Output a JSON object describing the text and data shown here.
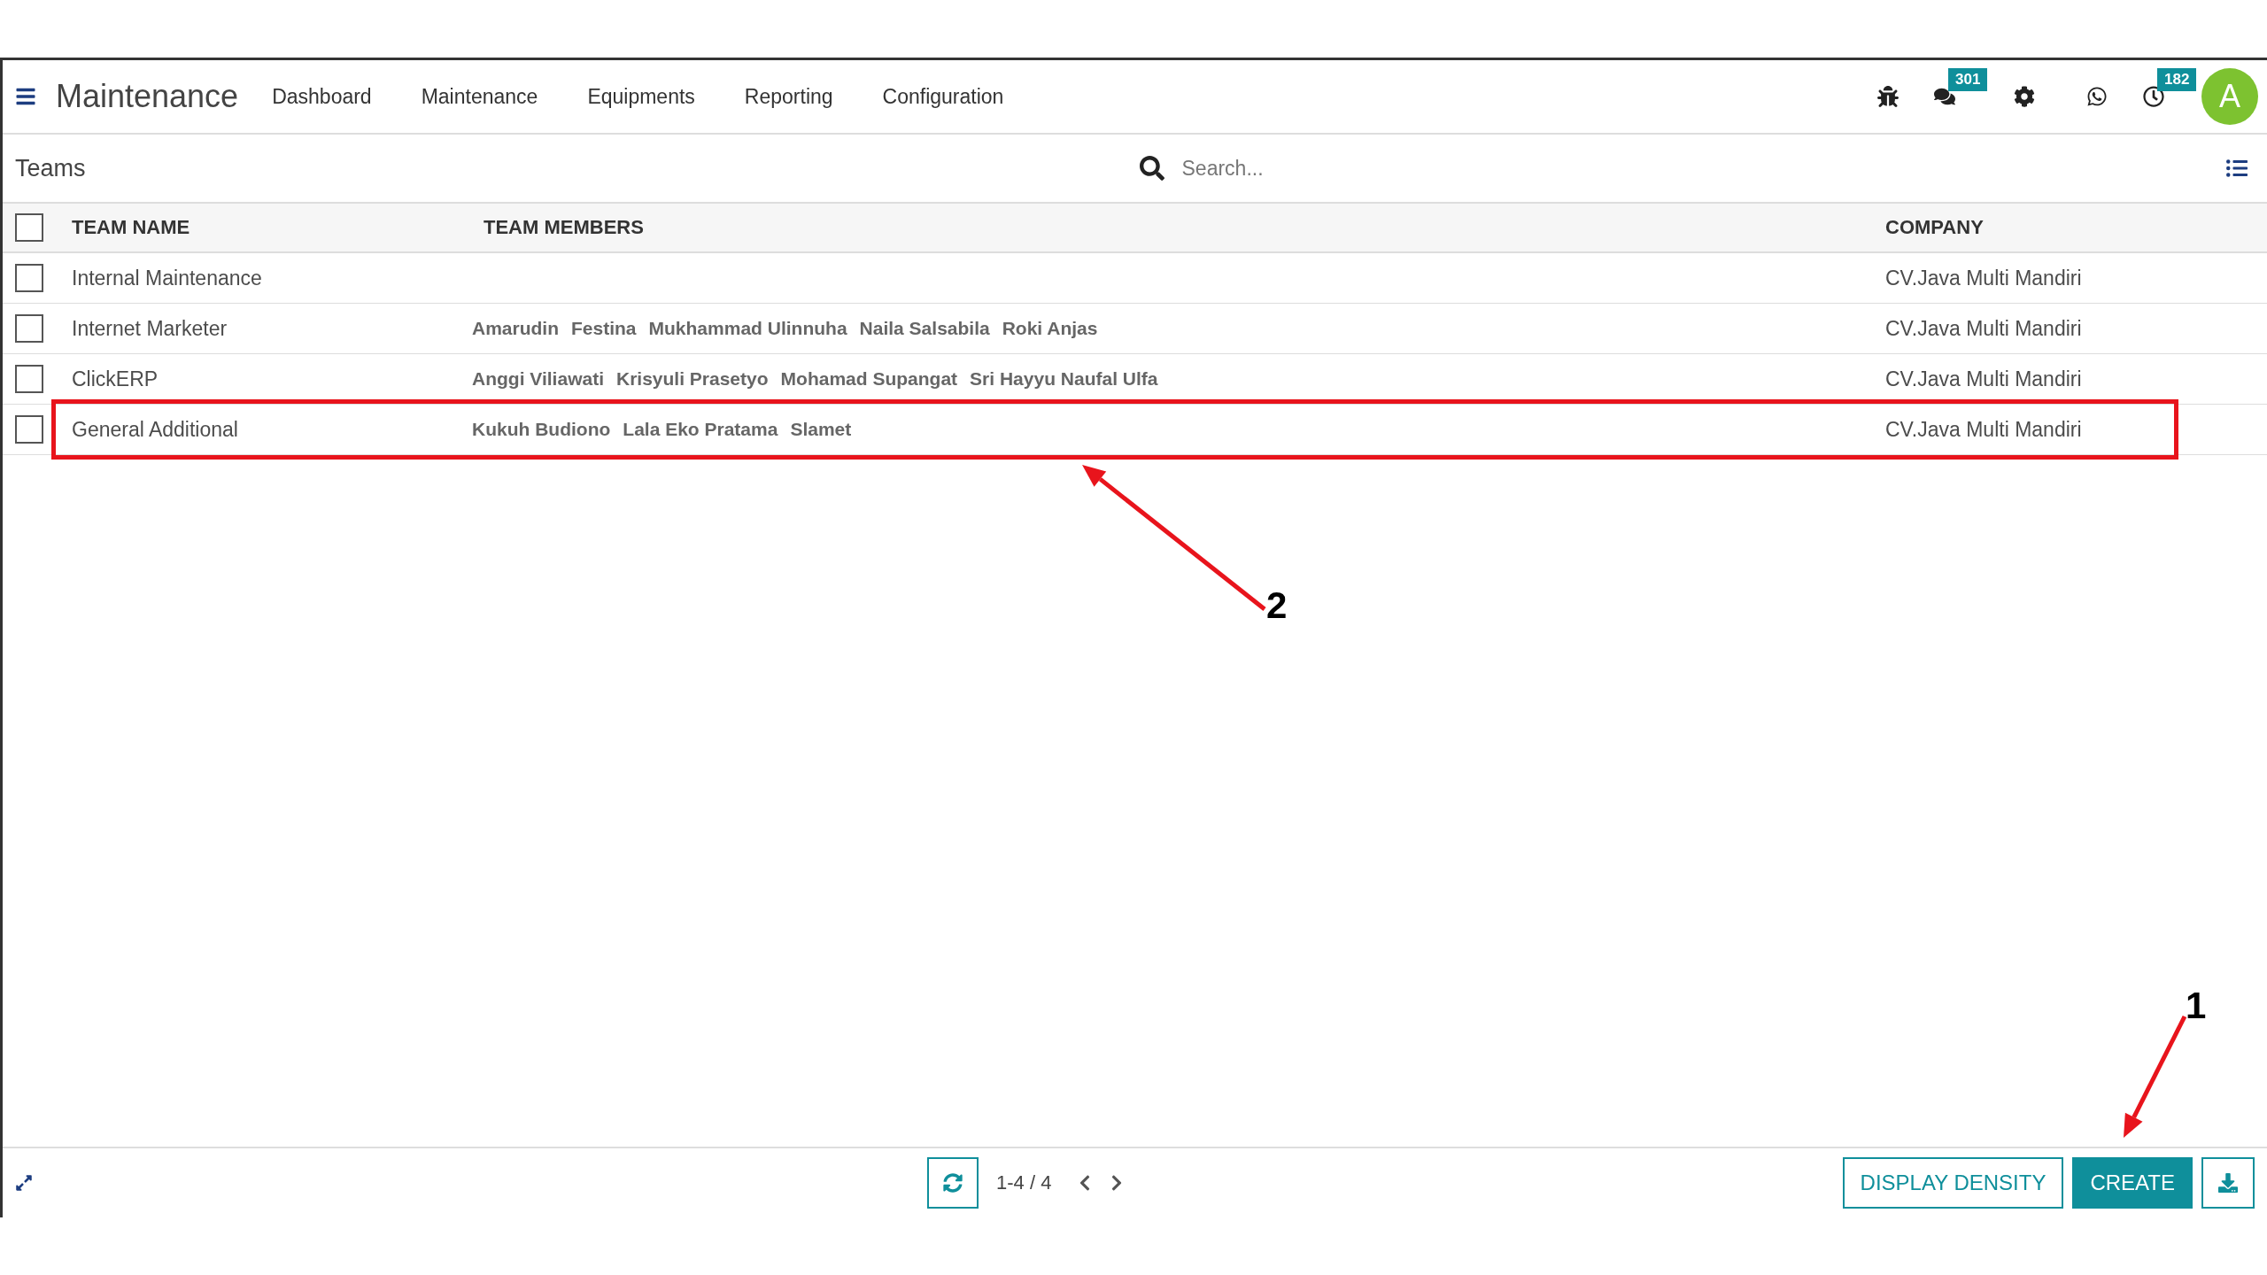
{
  "navbar": {
    "app_title": "Maintenance",
    "menu": [
      "Dashboard",
      "Maintenance",
      "Equipments",
      "Reporting",
      "Configuration"
    ],
    "messages_badge": "301",
    "activities_badge": "182",
    "avatar_letter": "A"
  },
  "control_panel": {
    "breadcrumb": "Teams",
    "search": {
      "placeholder": "Search..."
    }
  },
  "table": {
    "select_all": {
      "checked": false
    },
    "columns": [
      "TEAM NAME",
      "TEAM MEMBERS",
      "COMPANY"
    ],
    "rows": [
      {
        "checked": false,
        "highlighted": false,
        "team_name": "Internal Maintenance",
        "members": [],
        "company": "CV.Java Multi Mandiri"
      },
      {
        "checked": false,
        "highlighted": false,
        "team_name": "Internet Marketer",
        "members": [
          "Amarudin",
          "Festina",
          "Mukhammad Ulinnuha",
          "Naila Salsabila",
          "Roki Anjas"
        ],
        "company": "CV.Java Multi Mandiri"
      },
      {
        "checked": false,
        "highlighted": false,
        "team_name": "ClickERP",
        "members": [
          "Anggi Viliawati",
          "Krisyuli Prasetyo",
          "Mohamad Supangat",
          "Sri Hayyu Naufal Ulfa"
        ],
        "company": "CV.Java Multi Mandiri"
      },
      {
        "checked": false,
        "highlighted": true,
        "team_name": "General Additional",
        "members": [
          "Kukuh Budiono",
          "Lala Eko Pratama",
          "Slamet"
        ],
        "company": "CV.Java Multi Mandiri"
      }
    ]
  },
  "footer": {
    "pager": "1-4 / 4",
    "buttons": [
      {
        "kind": "outline",
        "label": "DISPLAY DENSITY"
      },
      {
        "kind": "primary",
        "label": "CREATE"
      }
    ]
  },
  "annotations": [
    {
      "label": "1"
    },
    {
      "label": "2"
    }
  ]
}
